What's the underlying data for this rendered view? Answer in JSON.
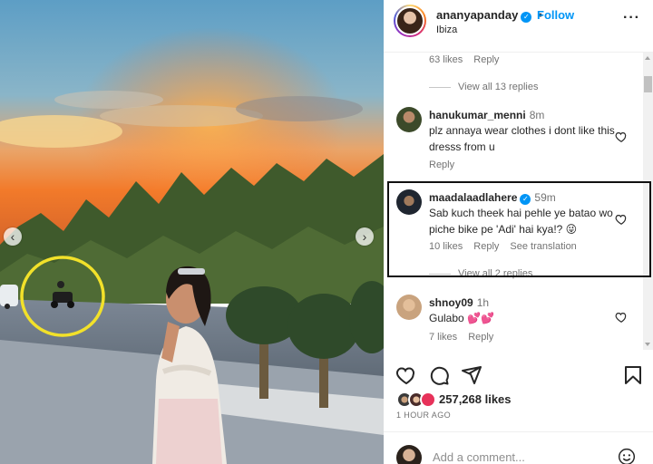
{
  "header": {
    "username": "ananyapanday",
    "follow_label": "Follow",
    "location": "Ibiza",
    "more_icon": "more-horizontal-icon"
  },
  "comments": {
    "prev_reply_meta": {
      "likes": "63 likes",
      "reply": "Reply"
    },
    "view_replies_13": "View all 13 replies",
    "items": [
      {
        "username": "hanukumar_menni",
        "time": "8m",
        "text": "plz annaya wear clothes i dont like this dresss from u",
        "reply": "Reply"
      },
      {
        "username": "maadalaadlahere",
        "verified": true,
        "time": "59m",
        "text": "Sab kuch theek hai pehle ye batao wo piche bike pe 'Adi' hai kya!? 😜",
        "likes": "10 likes",
        "reply": "Reply",
        "translate": "See translation",
        "view_replies": "View all 2 replies"
      },
      {
        "username": "shnoy09",
        "time": "1h",
        "text": "Gulabo 💕💕",
        "likes": "7 likes",
        "reply": "Reply"
      }
    ]
  },
  "actions": {
    "like_icon": "heart-icon",
    "comment_icon": "comment-icon",
    "share_icon": "share-icon",
    "save_icon": "bookmark-icon"
  },
  "likes": {
    "count_text": "257,268 likes"
  },
  "post_date": "1 HOUR AGO",
  "add_comment": {
    "placeholder": "Add a comment...",
    "emoji_icon": "smiley-icon"
  },
  "photo": {
    "prev_icon": "chevron-left-icon",
    "next_icon": "chevron-right-icon"
  },
  "colors": {
    "link_blue": "#0095f6",
    "annotation_circle": "#f2e12a",
    "annotation_box": "#111111"
  }
}
